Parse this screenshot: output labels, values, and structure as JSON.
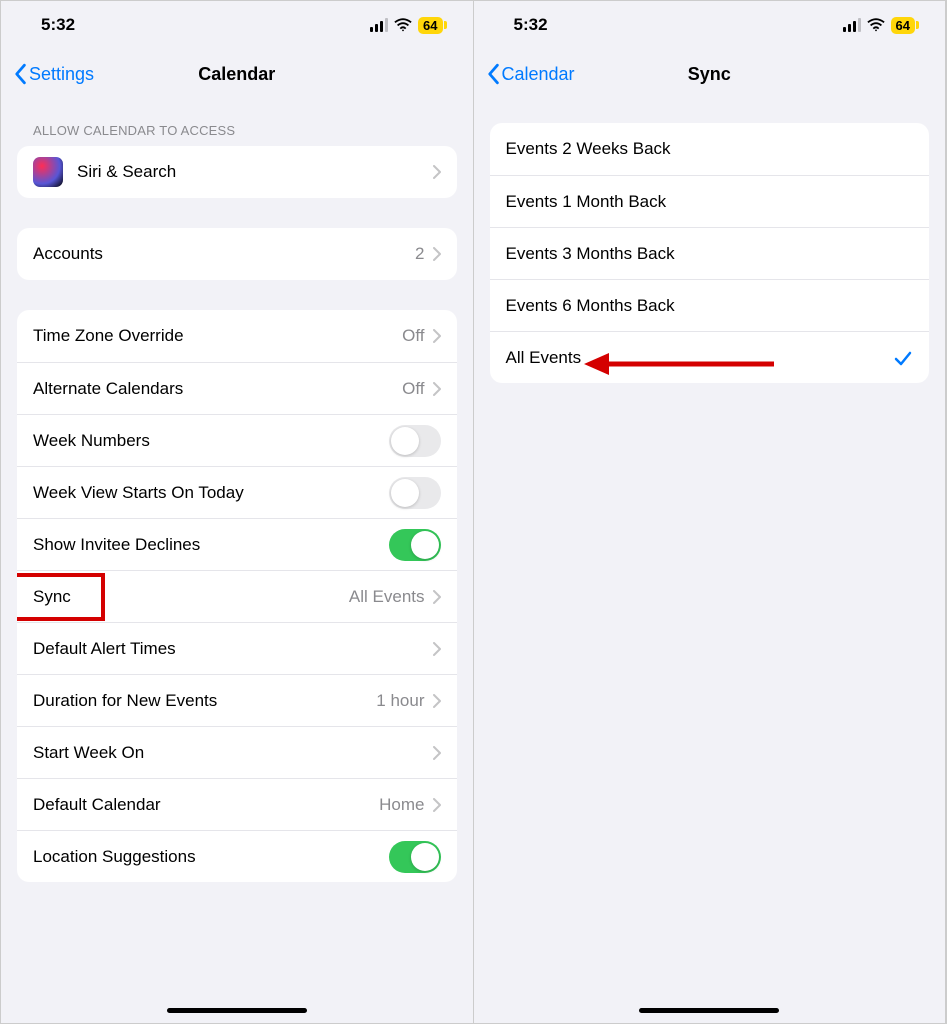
{
  "status": {
    "time": "5:32",
    "battery": "64"
  },
  "left": {
    "back": "Settings",
    "title": "Calendar",
    "access_header": "ALLOW CALENDAR TO ACCESS",
    "siri": "Siri & Search",
    "accounts": {
      "label": "Accounts",
      "value": "2"
    },
    "rows": {
      "tz": {
        "label": "Time Zone Override",
        "value": "Off"
      },
      "alt": {
        "label": "Alternate Calendars",
        "value": "Off"
      },
      "week": {
        "label": "Week Numbers"
      },
      "wvs": {
        "label": "Week View Starts On Today"
      },
      "inv": {
        "label": "Show Invitee Declines"
      },
      "sync": {
        "label": "Sync",
        "value": "All Events"
      },
      "dat": {
        "label": "Default Alert Times"
      },
      "dur": {
        "label": "Duration for New Events",
        "value": "1 hour"
      },
      "swo": {
        "label": "Start Week On"
      },
      "dc": {
        "label": "Default Calendar",
        "value": "Home"
      },
      "ls": {
        "label": "Location Suggestions"
      }
    }
  },
  "right": {
    "back": "Calendar",
    "title": "Sync",
    "options": [
      "Events 2 Weeks Back",
      "Events 1 Month Back",
      "Events 3 Months Back",
      "Events 6 Months Back",
      "All Events"
    ],
    "selected_index": 4
  }
}
